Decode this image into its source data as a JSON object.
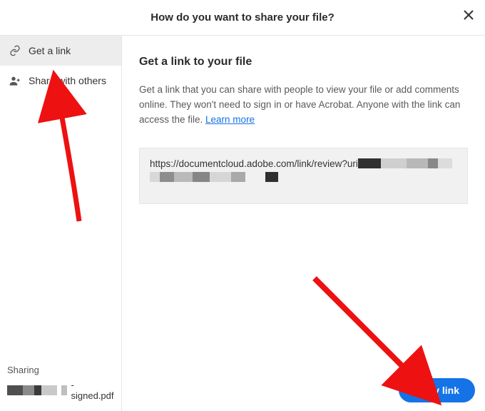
{
  "header": {
    "title": "How do you want to share your file?"
  },
  "sidebar": {
    "items": [
      {
        "label": "Get a link"
      },
      {
        "label": "Share with others"
      }
    ],
    "footer_label": "Sharing",
    "file_suffix": "-signed.pdf"
  },
  "main": {
    "heading": "Get a link to your file",
    "description_pre": "Get a link that you can share with people to view your file or add comments online. They won't need to sign in or have Acrobat. Anyone with the link can access the file. ",
    "learn_more": "Learn more",
    "link_visible": "https://documentcloud.adobe.com/link/review?uri"
  },
  "copy_button": "Copy link"
}
